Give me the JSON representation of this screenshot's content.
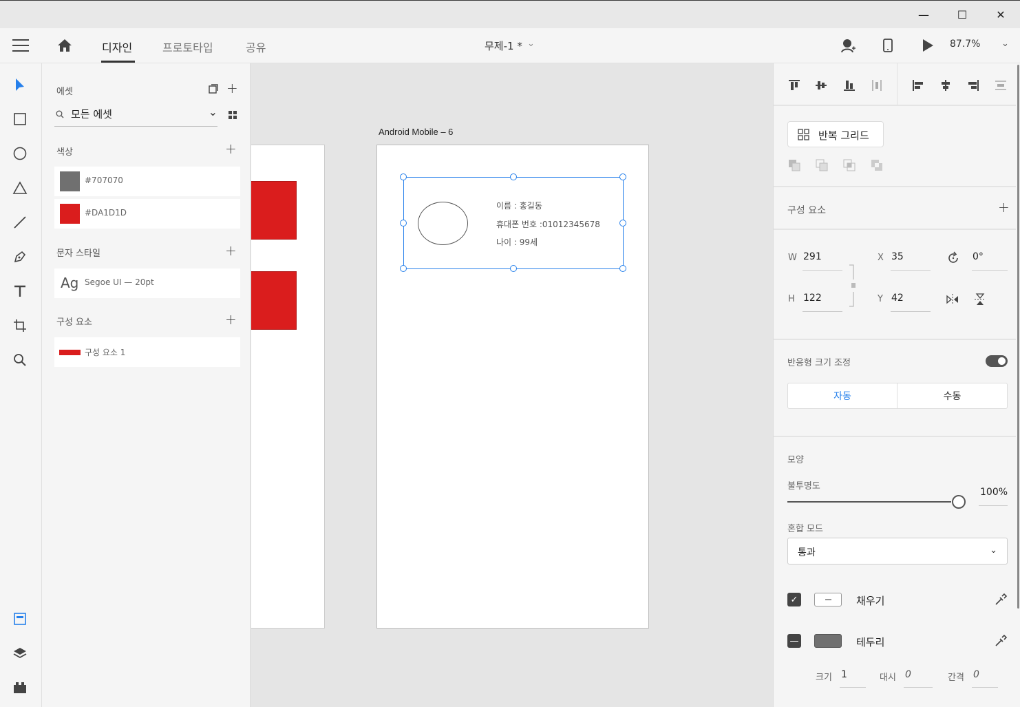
{
  "window": {
    "minimize_label": "—",
    "maximize_label": "☐",
    "close_label": "✕"
  },
  "header": {
    "tabs": [
      "디자인",
      "프로토타입",
      "공유"
    ],
    "doc_title": "무제-1 *",
    "zoom": "87.7%"
  },
  "assets": {
    "title": "에셋",
    "search_value": "모든 에셋",
    "colors_label": "색상",
    "colors": [
      {
        "hex": "#707070",
        "label": "#707070"
      },
      {
        "hex": "#DA1D1D",
        "label": "#DA1D1D"
      }
    ],
    "char_styles_label": "문자 스타일",
    "char_style": {
      "sample": "Ag",
      "label": "Segoe UI — 20pt"
    },
    "components_label": "구성 요소",
    "component": {
      "label": "구성 요소 1"
    }
  },
  "canvas": {
    "artboard_name": "Android Mobile – 6",
    "card": {
      "name_line": "이름 : 홍길동",
      "phone_line": "휴대폰 번호 :01012345678",
      "age_line": "나이 : 99세"
    },
    "accent": "#2680eb",
    "red": "#da1d1d"
  },
  "properties": {
    "repeat_grid": "반복 그리드",
    "component_label": "구성 요소",
    "w_label": "W",
    "w_value": "291",
    "h_label": "H",
    "h_value": "122",
    "x_label": "X",
    "x_value": "35",
    "y_label": "Y",
    "y_value": "42",
    "rotation": "0°",
    "responsive_label": "반응형 크기 조정",
    "responsive_on": true,
    "auto_label": "자동",
    "manual_label": "수동",
    "appearance_label": "모양",
    "opacity_label": "불투명도",
    "opacity_value": "100%",
    "blend_label": "혼합 모드",
    "blend_value": "통과",
    "fill_label": "채우기",
    "stroke_label": "테두리",
    "stroke_size_label": "크기",
    "stroke_size": "1",
    "dash_label": "대시",
    "dash_value": "0",
    "gap_label": "간격",
    "gap_value": "0"
  }
}
